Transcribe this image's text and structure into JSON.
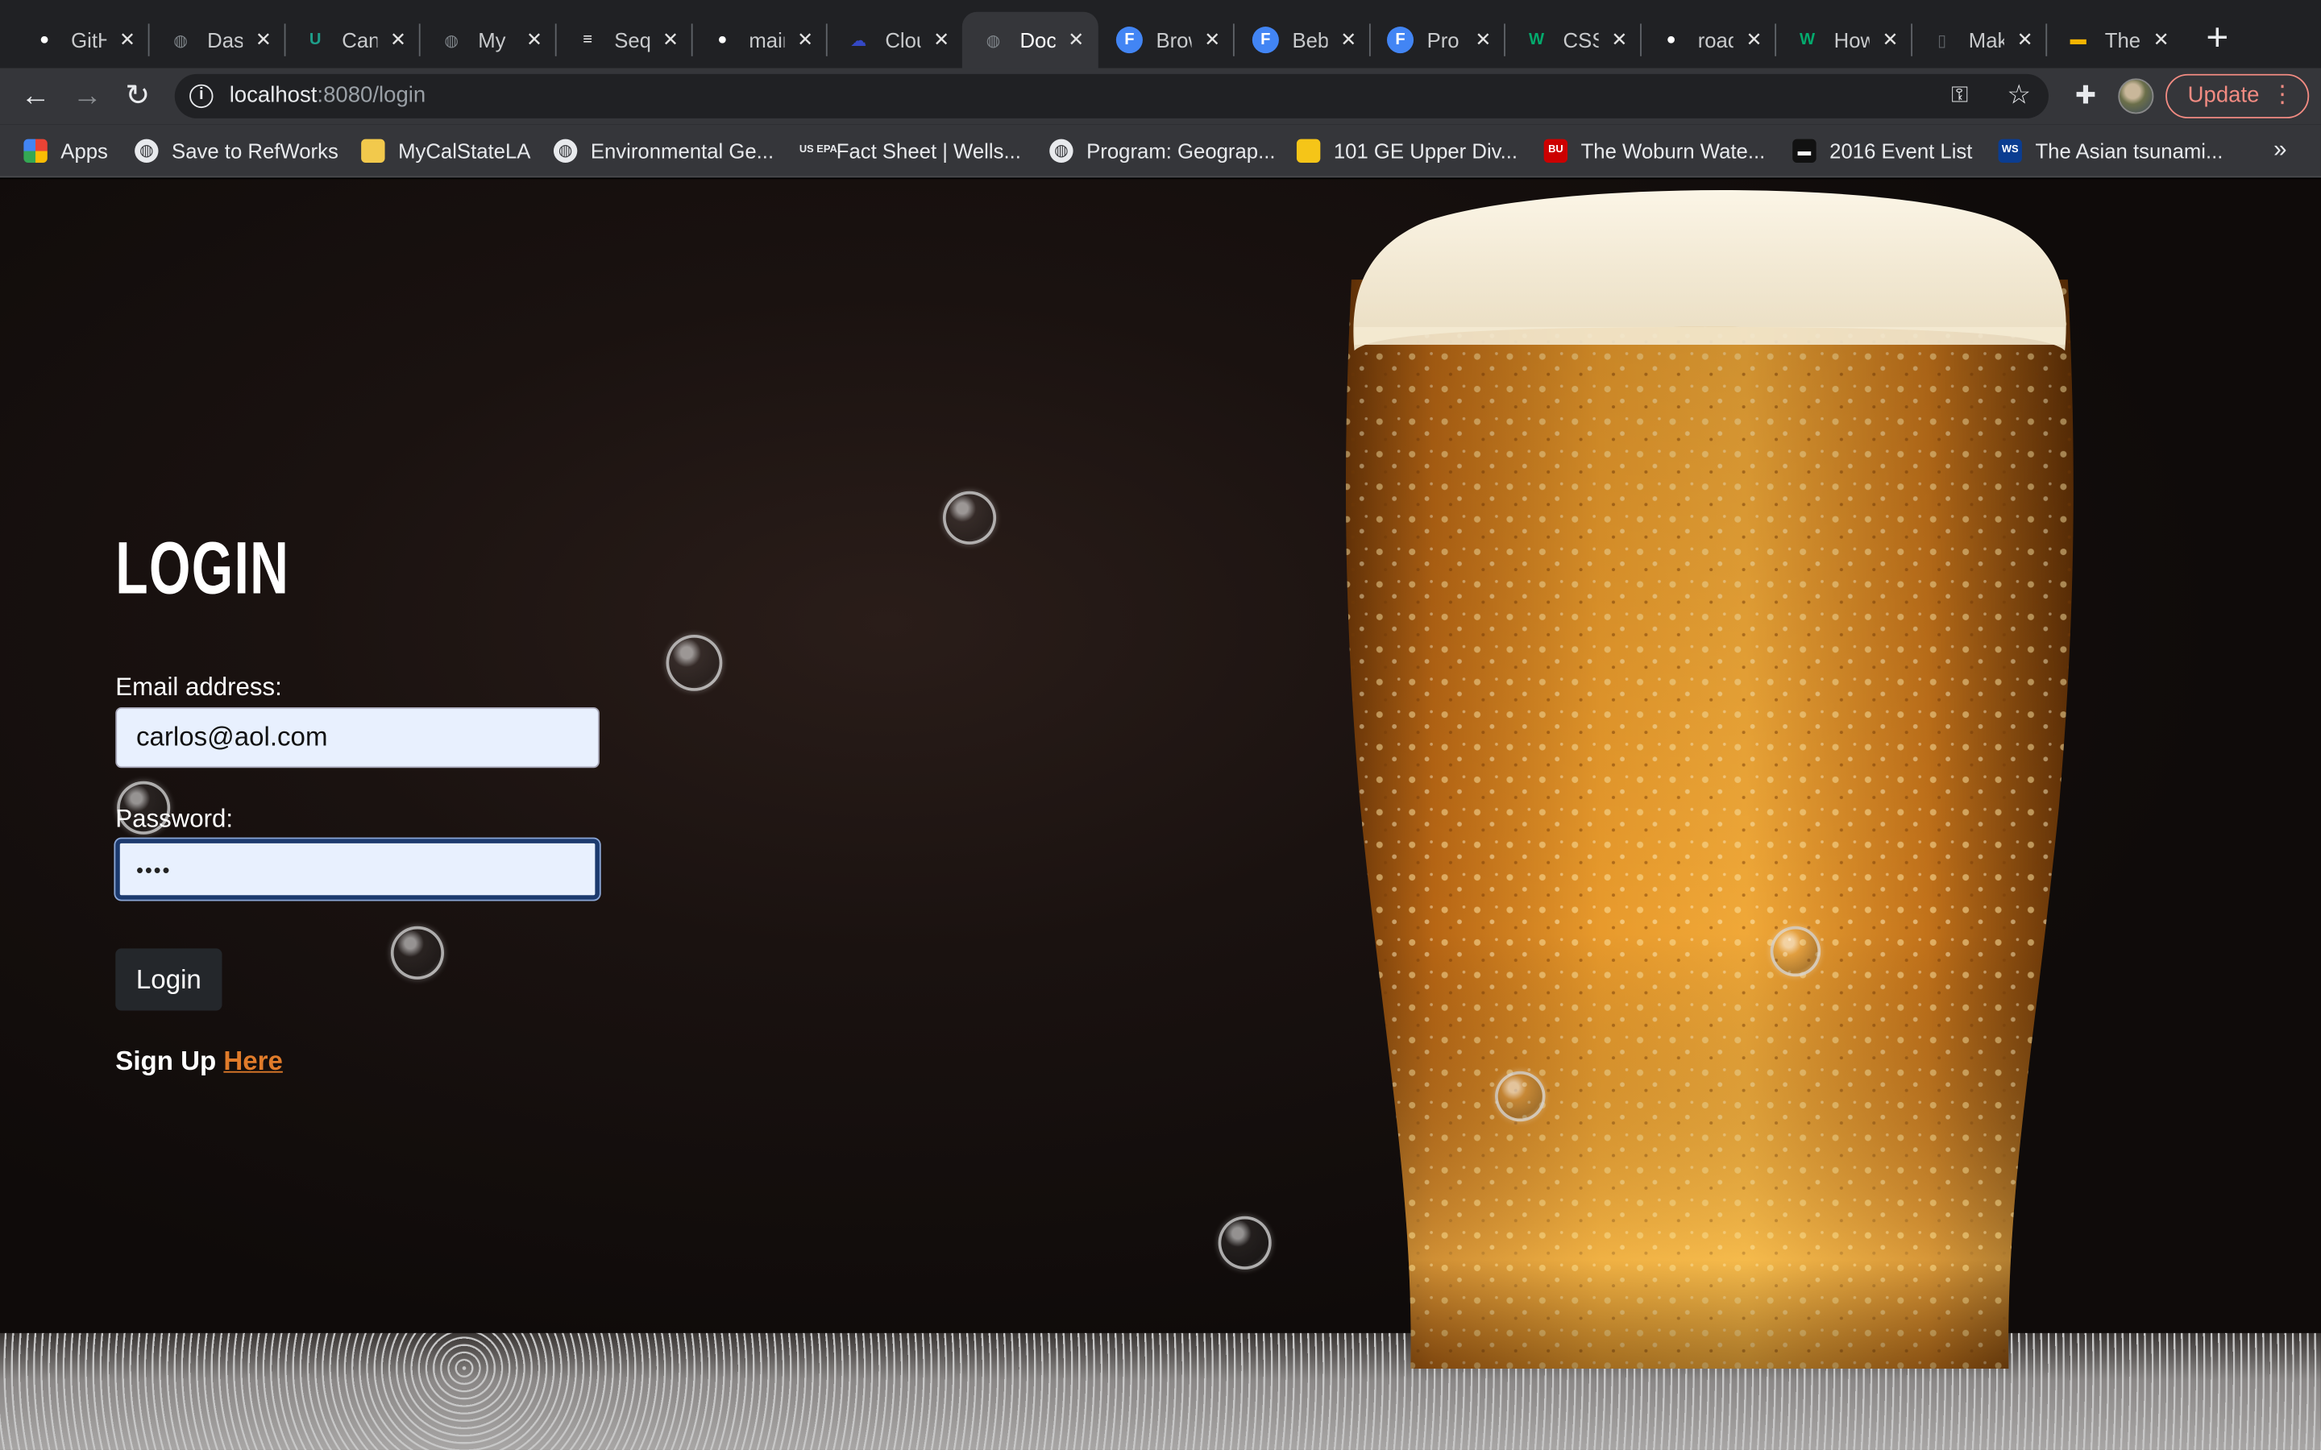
{
  "browser": {
    "tabs": [
      {
        "title": "GitHub",
        "favicon": "github-icon",
        "color": "#ffffff",
        "active": false
      },
      {
        "title": "Dashboard",
        "favicon": "globe-icon",
        "color": "#80868b",
        "active": false
      },
      {
        "title": "Canvas",
        "favicon": "canvas-icon",
        "color": "#1e9e8a",
        "active": false
      },
      {
        "title": "My",
        "favicon": "globe-icon",
        "color": "#80868b",
        "active": false
      },
      {
        "title": "Sequelize",
        "favicon": "sequelize-icon",
        "color": "#ffffff",
        "active": false
      },
      {
        "title": "main",
        "favicon": "github-icon",
        "color": "#ffffff",
        "active": false
      },
      {
        "title": "Cloudinary",
        "favicon": "cloud-icon",
        "color": "#3448c5",
        "active": false
      },
      {
        "title": "Document",
        "favicon": "globe-icon",
        "color": "#80868b",
        "active": true
      },
      {
        "title": "Browse",
        "favicon": "f-icon",
        "color": "#4285f4",
        "active": false
      },
      {
        "title": "Beb",
        "favicon": "f-icon",
        "color": "#4285f4",
        "active": false
      },
      {
        "title": "Pro",
        "favicon": "f-icon",
        "color": "#4285f4",
        "active": false
      },
      {
        "title": "CSS",
        "favicon": "w3schools-icon",
        "color": "#04aa6d",
        "active": false
      },
      {
        "title": "roadmap",
        "favicon": "github-icon",
        "color": "#ffffff",
        "active": false
      },
      {
        "title": "How",
        "favicon": "w3schools-icon",
        "color": "#04aa6d",
        "active": false
      },
      {
        "title": "Mak",
        "favicon": "doc-icon",
        "color": "#5f6368",
        "active": false
      },
      {
        "title": "The",
        "favicon": "slides-icon",
        "color": "#f4b400",
        "active": false
      }
    ],
    "new_tab_label": "+",
    "url_host": "localhost",
    "url_rest": ":8080/login",
    "update_label": "Update",
    "bookmarks": [
      {
        "label": "Apps",
        "icon": "apps-grid-icon"
      },
      {
        "label": "Save to RefWorks",
        "icon": "globe-icon"
      },
      {
        "label": "MyCalStateLA",
        "icon": "shield-icon"
      },
      {
        "label": "Environmental Ge...",
        "icon": "globe-icon"
      },
      {
        "label": "Fact Sheet | Wells...",
        "icon": "epa-icon",
        "icon_text": "US EPA"
      },
      {
        "label": "Program: Geograp...",
        "icon": "globe-icon"
      },
      {
        "label": "101 GE Upper Div...",
        "icon": "calstatela-icon"
      },
      {
        "label": "The Woburn Wate...",
        "icon": "bu-icon",
        "icon_text": "BU"
      },
      {
        "label": "2016 Event List",
        "icon": "event-icon"
      },
      {
        "label": "The Asian tsunami...",
        "icon": "ws-icon",
        "icon_text": "WS"
      }
    ],
    "bookmarks_more": "»"
  },
  "login": {
    "title": "LOGIN",
    "email_label": "Email address:",
    "email_value": "carlos@aol.com",
    "password_label": "Password:",
    "password_mask": "••••",
    "button_label": "Login",
    "signup_text": "Sign Up",
    "signup_link": "Here"
  },
  "colors": {
    "link": "#e07b2a",
    "update": "#f28b82",
    "input_bg": "#e8f0fe",
    "button_bg": "#24272b"
  }
}
